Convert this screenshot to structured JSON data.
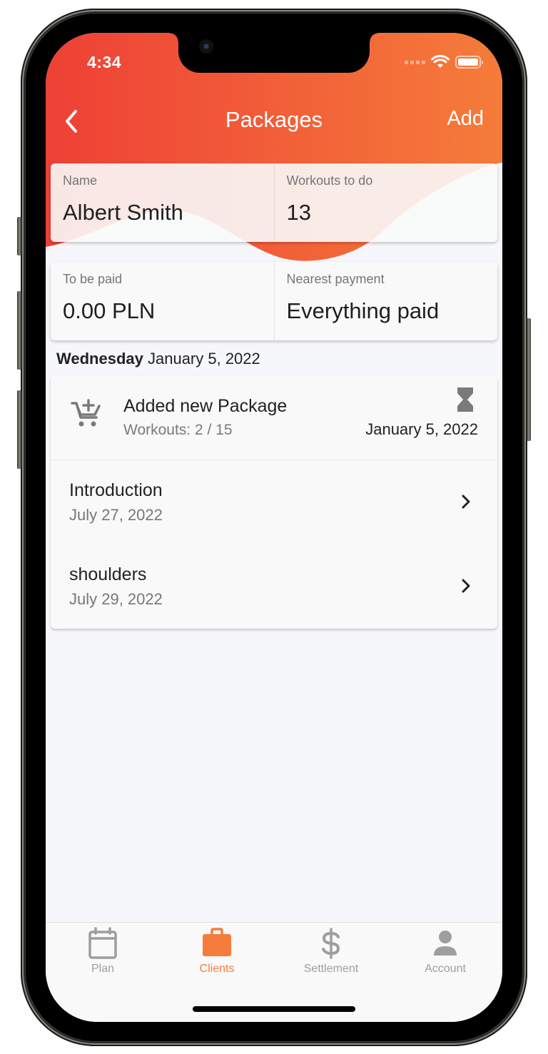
{
  "status_bar": {
    "time": "4:34",
    "icons": [
      "cellular-signal-icon",
      "wifi-icon",
      "battery-icon"
    ]
  },
  "nav": {
    "back_icon": "chevron-left-icon",
    "title": "Packages",
    "action_label": "Add"
  },
  "summary": {
    "name_label": "Name",
    "name_value": "Albert Smith",
    "workouts_label": "Workouts to do",
    "workouts_value": "13",
    "to_pay_label": "To be paid",
    "to_pay_value": "0.00 PLN",
    "nearest_label": "Nearest payment",
    "nearest_value": "Everything paid"
  },
  "day": {
    "weekday": "Wednesday",
    "date": "January 5, 2022"
  },
  "package": {
    "icon": "cart-add-icon",
    "title": "Added new Package",
    "subtitle": "Workouts: 2 / 15",
    "status_icon": "hourglass-icon",
    "date": "January 5, 2022"
  },
  "workouts": [
    {
      "title": "Introduction",
      "date": "July 27, 2022"
    },
    {
      "title": "shoulders",
      "date": "July 29, 2022"
    }
  ],
  "tabs": [
    {
      "label": "Plan",
      "icon": "calendar-icon",
      "active": false
    },
    {
      "label": "Clients",
      "icon": "briefcase-icon",
      "active": true
    },
    {
      "label": "Settlement",
      "icon": "dollar-icon",
      "active": false
    },
    {
      "label": "Account",
      "icon": "person-icon",
      "active": false
    }
  ],
  "colors": {
    "header_gradient_start": "#ee4036",
    "header_gradient_end": "#f57c3a",
    "accent": "#f57c3a",
    "inactive_tab": "#9e9e9e",
    "screen_background": "#f6f7fb"
  }
}
